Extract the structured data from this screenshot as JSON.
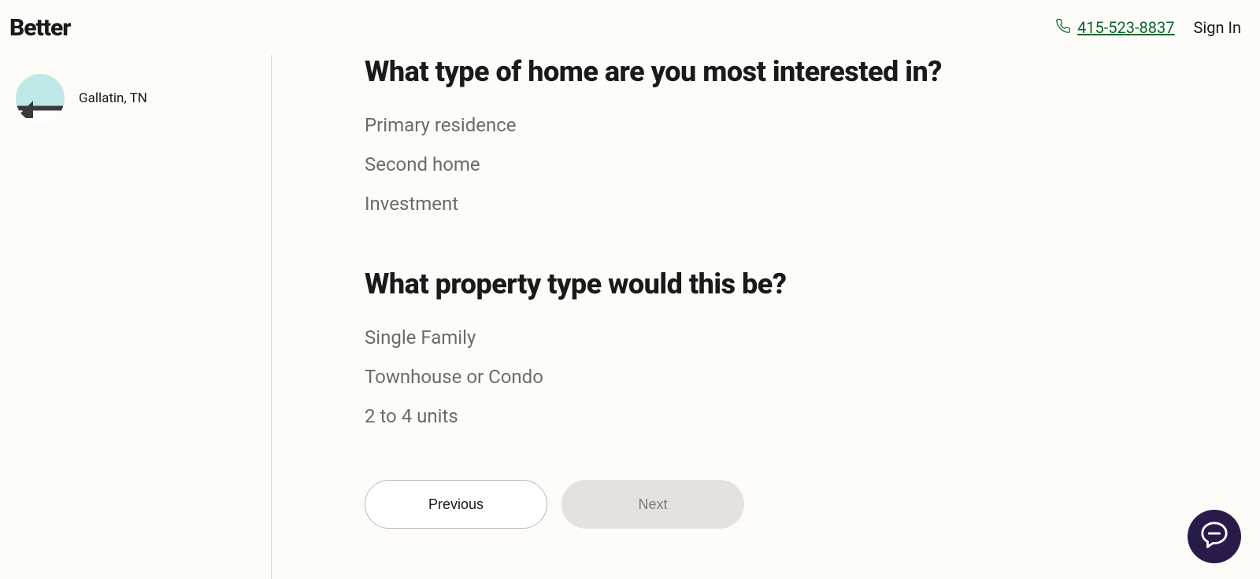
{
  "header": {
    "logo": "Better",
    "phone": "415-523-8837",
    "sign_in": "Sign In"
  },
  "sidebar": {
    "location": "Gallatin, TN"
  },
  "main": {
    "question1": {
      "title": "What type of home are you most interested in?",
      "options": [
        "Primary residence",
        "Second home",
        "Investment"
      ]
    },
    "question2": {
      "title": "What property type would this be?",
      "options": [
        "Single Family",
        "Townhouse or Condo",
        "2 to 4 units"
      ]
    },
    "buttons": {
      "previous": "Previous",
      "next": "Next"
    }
  }
}
